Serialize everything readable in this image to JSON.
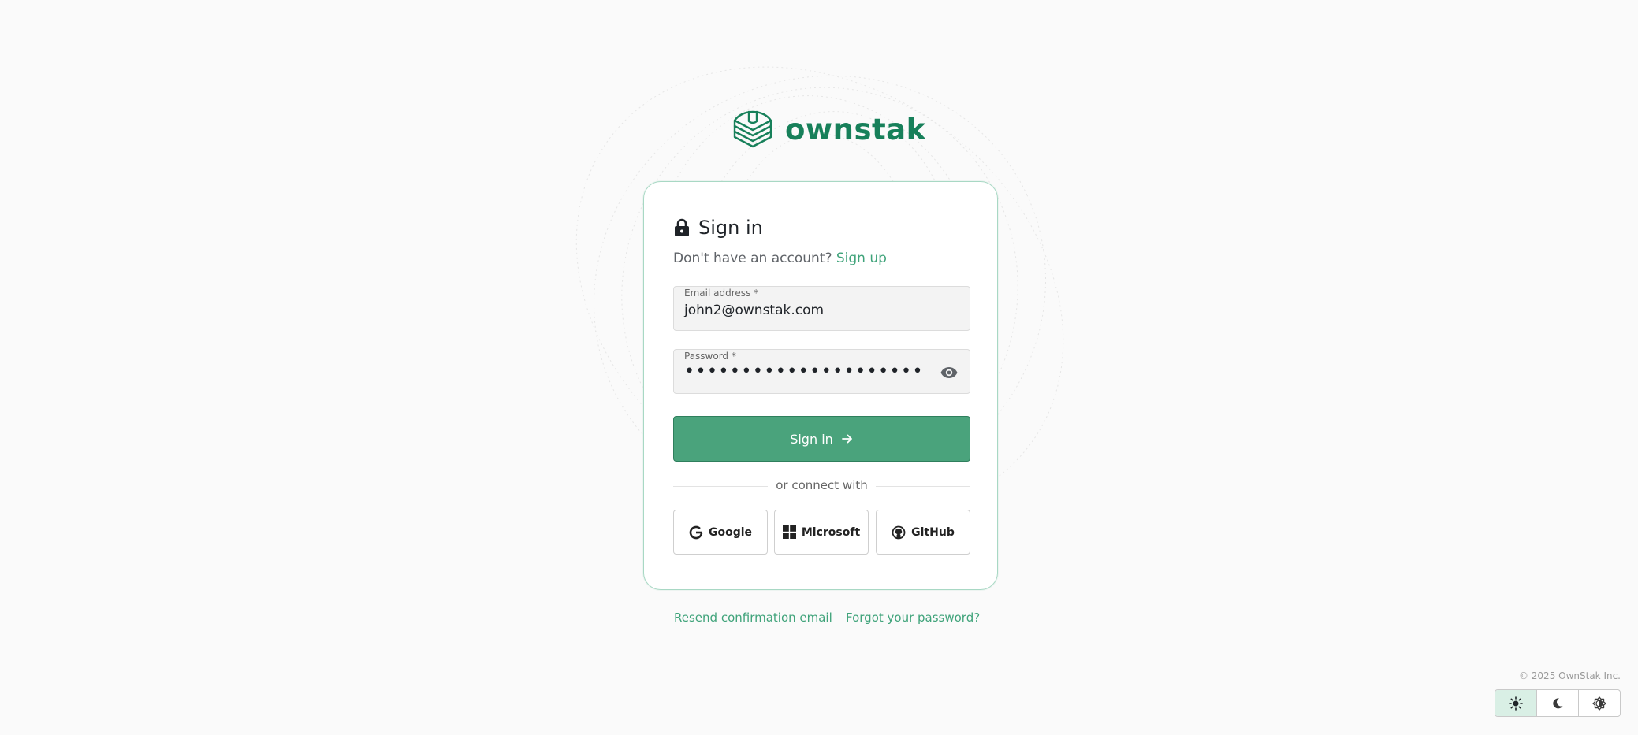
{
  "brand": {
    "name": "ownstak",
    "color": "#17805a",
    "logo_icon": "ownstak-logo-icon"
  },
  "signin_card": {
    "title": "Sign in",
    "title_icon": "lock-icon",
    "subtitle_text": "Don't have an account?",
    "signup_link": "Sign up",
    "email": {
      "label": "Email address *",
      "value": "john2@ownstak.com"
    },
    "password": {
      "label": "Password *",
      "value": "•••••••••••••••••••••",
      "toggle_icon": "eye-icon"
    },
    "submit_label": "Sign in",
    "submit_icon": "arrow-right-icon",
    "divider_text": "or connect with",
    "social": [
      {
        "label": "Google",
        "icon": "google-icon"
      },
      {
        "label": "Microsoft",
        "icon": "microsoft-icon"
      },
      {
        "label": "GitHub",
        "icon": "github-icon"
      }
    ]
  },
  "links": {
    "resend": "Resend confirmation email",
    "forgot": "Forgot your password?"
  },
  "footer": {
    "copyright": "© 2025 OwnStak Inc."
  },
  "theme_switch": {
    "options": [
      {
        "icon": "sun-icon",
        "active": true
      },
      {
        "icon": "moon-icon",
        "active": false
      },
      {
        "icon": "auto-brightness-icon",
        "active": false
      }
    ]
  },
  "colors": {
    "accent": "#4aa37c",
    "link": "#3fa37a",
    "card_border": "#a8d8c4",
    "background": "#fafafa"
  }
}
